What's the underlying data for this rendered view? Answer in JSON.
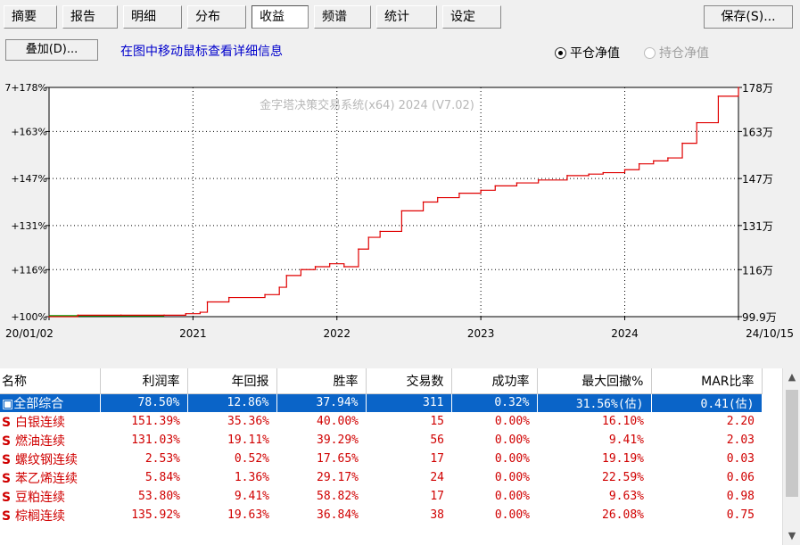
{
  "toolbar": {
    "tabs": [
      "摘要",
      "报告",
      "明细",
      "分布",
      "收益",
      "频谱",
      "统计",
      "设定"
    ],
    "active_tab": "收益",
    "save_label": "保存(S)..."
  },
  "subbar": {
    "overlay_label": "叠加(D)...",
    "hint": "在图中移动鼠标查看详细信息",
    "radio_close": "平仓净值",
    "radio_hold": "持仓净值"
  },
  "chart_data": {
    "type": "line",
    "watermark": "金字塔决策交易系统(x64) 2024 (V7.02)",
    "x_tick_labels": [
      "20/01/02",
      "2021",
      "2022",
      "2023",
      "2024",
      "24/10/15"
    ],
    "y_left_ticks": [
      "7+178%",
      "+163%",
      "+147%",
      "+131%",
      "+116%",
      "+100%"
    ],
    "y_right_ticks": [
      "178万",
      "163万",
      "147万",
      "131万",
      "116万",
      "99.9万"
    ],
    "ylim": [
      100,
      178
    ],
    "x": [
      2020.0,
      2020.2,
      2020.5,
      2020.8,
      2020.95,
      2021.05,
      2021.1,
      2021.25,
      2021.5,
      2021.6,
      2021.65,
      2021.75,
      2021.85,
      2021.95,
      2022.05,
      2022.15,
      2022.22,
      2022.3,
      2022.45,
      2022.6,
      2022.7,
      2022.85,
      2023.0,
      2023.1,
      2023.25,
      2023.4,
      2023.6,
      2023.75,
      2023.85,
      2024.0,
      2024.1,
      2024.2,
      2024.3,
      2024.4,
      2024.5,
      2024.65,
      2024.79
    ],
    "values": [
      100,
      100.5,
      100.5,
      100.5,
      101,
      101.5,
      105,
      106.5,
      107.5,
      110,
      114,
      116,
      117,
      118,
      117,
      123,
      127,
      129,
      136,
      139,
      140.5,
      142,
      143,
      144.5,
      145.5,
      146.5,
      148,
      148.5,
      149,
      150,
      152,
      153,
      154,
      159,
      166,
      175,
      178
    ]
  },
  "table": {
    "headers": [
      "名称",
      "利润率",
      "年回报",
      "胜率",
      "交易数",
      "成功率",
      "最大回撤%",
      "MAR比率"
    ],
    "rows": [
      {
        "name": "全部综合",
        "prefix": "",
        "cells": [
          "78.50%",
          "12.86%",
          "37.94%",
          "311",
          "0.32%",
          "31.56%(估)",
          "0.41(估)"
        ]
      },
      {
        "name": "白银连续",
        "prefix": "S",
        "cells": [
          "151.39%",
          "35.36%",
          "40.00%",
          "15",
          "0.00%",
          "16.10%",
          "2.20"
        ]
      },
      {
        "name": "燃油连续",
        "prefix": "S",
        "cells": [
          "131.03%",
          "19.11%",
          "39.29%",
          "56",
          "0.00%",
          "9.41%",
          "2.03"
        ]
      },
      {
        "name": "螺纹钢连续",
        "prefix": "S",
        "cells": [
          "2.53%",
          "0.52%",
          "17.65%",
          "17",
          "0.00%",
          "19.19%",
          "0.03"
        ]
      },
      {
        "name": "苯乙烯连续",
        "prefix": "S",
        "cells": [
          "5.84%",
          "1.36%",
          "29.17%",
          "24",
          "0.00%",
          "22.59%",
          "0.06"
        ]
      },
      {
        "name": "豆粕连续",
        "prefix": "S",
        "cells": [
          "53.80%",
          "9.41%",
          "58.82%",
          "17",
          "0.00%",
          "9.63%",
          "0.98"
        ]
      },
      {
        "name": "棕榈连续",
        "prefix": "S",
        "cells": [
          "135.92%",
          "19.63%",
          "36.84%",
          "38",
          "0.00%",
          "26.08%",
          "0.75"
        ]
      }
    ]
  }
}
